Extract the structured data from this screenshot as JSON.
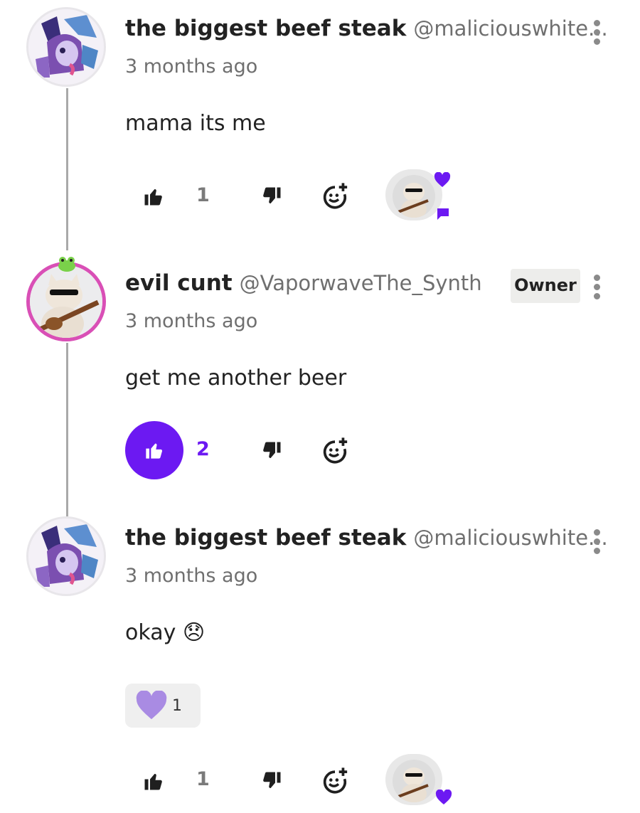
{
  "comments": [
    {
      "author": "the biggest beef steak",
      "handle": "@maliciouswhite...",
      "time": "3 months ago",
      "text": "mama its me",
      "likes": "1"
    },
    {
      "author": "evil cunt",
      "handle": "@VaporwaveThe_Synth",
      "badge": "Owner",
      "time": "3 months ago",
      "text": "get me another beer",
      "likes": "2"
    },
    {
      "author": "the biggest beef steak",
      "handle": "@maliciouswhite...",
      "time": "3 months ago",
      "text": "okay 😞",
      "reaction_count": "1",
      "likes": "1"
    }
  ],
  "colors": {
    "accent": "#6c19f2",
    "owner_ring": "#d94fb6",
    "heart": "#a98be3"
  },
  "icons": [
    "kebab-menu-icon",
    "thumbs-up-icon",
    "thumbs-down-icon",
    "add-reaction-icon",
    "heart-icon",
    "comment-bubble-icon"
  ]
}
